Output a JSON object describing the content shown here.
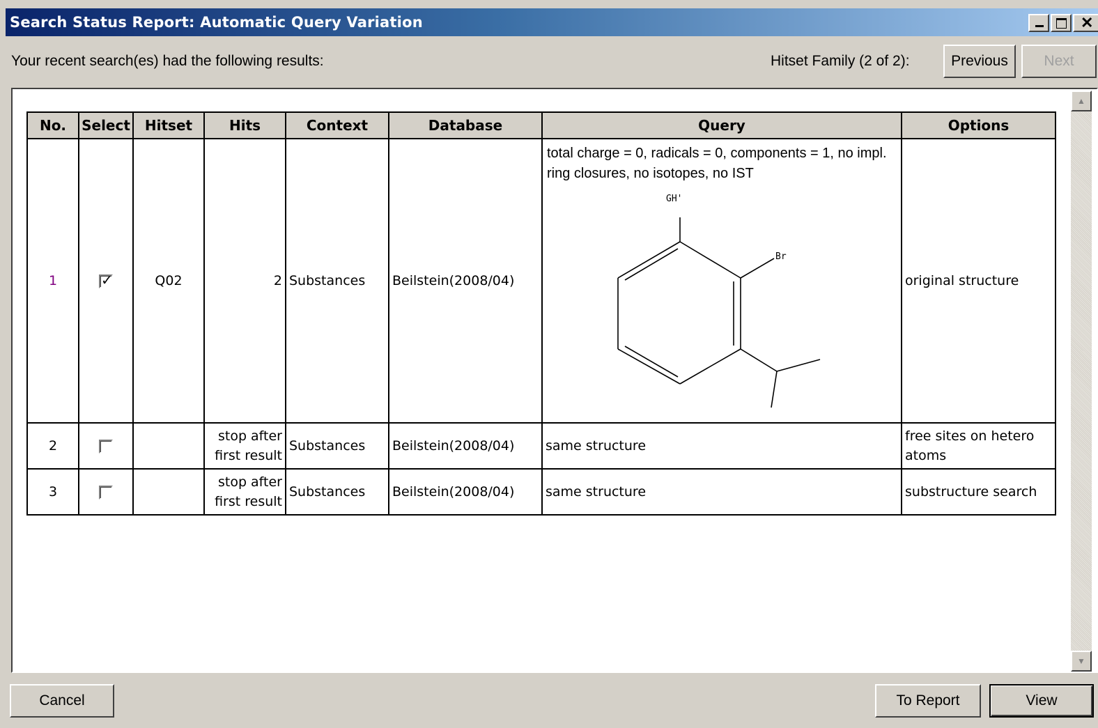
{
  "window": {
    "title": "Search Status Report: Automatic Query Variation",
    "controls": [
      "minimize-icon",
      "maximize-icon",
      "close-icon"
    ]
  },
  "header": {
    "intro": "Your recent search(es) had the following results:",
    "hitset_family": "Hitset Family (2 of 2):",
    "previous_label": "Previous",
    "next_label": "Next"
  },
  "table": {
    "headers": [
      "No.",
      "Select",
      "Hitset",
      "Hits",
      "Context",
      "Database",
      "Query",
      "Options"
    ],
    "rows": [
      {
        "no": "1",
        "selected": true,
        "hitset": "Q02",
        "hits": "2",
        "context": "Substances",
        "database": "Beilstein(2008/04)",
        "query": "total charge = 0, radicals = 0, components = 1, no impl. ring closures, no isotopes, no IST",
        "structure_labels": {
          "top": "GH'",
          "right": "Br"
        },
        "options": "original structure"
      },
      {
        "no": "2",
        "selected": false,
        "hitset": "",
        "hits": "stop after first result",
        "context": "Substances",
        "database": "Beilstein(2008/04)",
        "query": "same structure",
        "options": "free sites on hetero atoms"
      },
      {
        "no": "3",
        "selected": false,
        "hitset": "",
        "hits": "stop after first result",
        "context": "Substances",
        "database": "Beilstein(2008/04)",
        "query": "same structure",
        "options": "substructure search"
      }
    ]
  },
  "footer": {
    "cancel_label": "Cancel",
    "to_report_label": "To Report",
    "view_label": "View"
  }
}
